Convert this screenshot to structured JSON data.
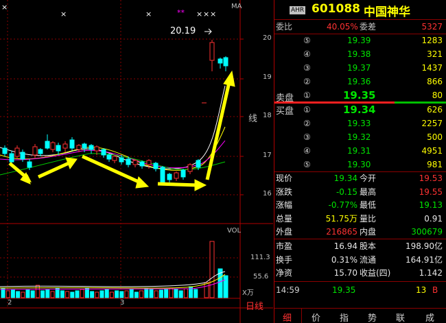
{
  "chart": {
    "ma_label": "MA",
    "vol_label": "VOL",
    "high_marker": "20.19",
    "star_marker": "**",
    "x_marker": "×",
    "price_axis": [
      "20",
      "19",
      "18",
      "17",
      "16"
    ],
    "vol_axis": [
      "111.3",
      "55.6",
      "X万"
    ],
    "date_labels": [
      "2",
      "3"
    ],
    "day_line_label": "日线",
    "k_line_label": "线"
  },
  "header": {
    "tag": "AHR",
    "code": "601088",
    "name": "中国神华"
  },
  "order_book": {
    "webi_label": "委比",
    "webi_value": "40.05%",
    "weicha_label": "委差",
    "weicha_value": "5327",
    "sell_label": "卖盘",
    "buy_label": "买盘",
    "asks": [
      {
        "level": "⑤",
        "price": "19.39",
        "vol": "1283"
      },
      {
        "level": "④",
        "price": "19.38",
        "vol": "321"
      },
      {
        "level": "③",
        "price": "19.37",
        "vol": "1437"
      },
      {
        "level": "②",
        "price": "19.36",
        "vol": "866"
      },
      {
        "level": "①",
        "price": "19.35",
        "vol": "80"
      }
    ],
    "bids": [
      {
        "level": "①",
        "price": "19.34",
        "vol": "626"
      },
      {
        "level": "②",
        "price": "19.33",
        "vol": "2257"
      },
      {
        "level": "③",
        "price": "19.32",
        "vol": "500"
      },
      {
        "level": "④",
        "price": "19.31",
        "vol": "4951"
      },
      {
        "level": "⑤",
        "price": "19.30",
        "vol": "981"
      }
    ]
  },
  "quote": {
    "rows": [
      {
        "l1": "现价",
        "v1": "19.34",
        "l2": "今开",
        "v2": "19.53"
      },
      {
        "l1": "涨跌",
        "v1": "-0.15",
        "l2": "最高",
        "v2": "19.55"
      },
      {
        "l1": "涨幅",
        "v1": "-0.77%",
        "l2": "最低",
        "v2": "19.13"
      },
      {
        "l1": "总量",
        "v1": "51.75万",
        "l2": "量比",
        "v2": "0.91"
      },
      {
        "l1": "外盘",
        "v1": "216865",
        "l2": "内盘",
        "v2": "300679"
      }
    ],
    "rows2": [
      {
        "l1": "市盈",
        "v1": "16.94",
        "l2": "股本",
        "v2": "198.90亿"
      },
      {
        "l1": "换手",
        "v1": "0.31%",
        "l2": "流通",
        "v2": "164.91亿"
      },
      {
        "l1": "净资",
        "v1": "15.70",
        "l2": "收益(四)",
        "v2": "1.142"
      }
    ]
  },
  "tick": {
    "time": "14:59",
    "price": "19.35",
    "vol": "13",
    "side": "B"
  },
  "tabs": [
    "细",
    "价",
    "指",
    "势",
    "联",
    "成"
  ],
  "chart_data": {
    "type": "candlestick",
    "price_axis": {
      "ticks": [
        16,
        17,
        18,
        19,
        20
      ]
    },
    "volume_axis": {
      "ticks": [
        55.6,
        111.3
      ],
      "unit": "万"
    },
    "annotations": [
      "20.19"
    ]
  }
}
